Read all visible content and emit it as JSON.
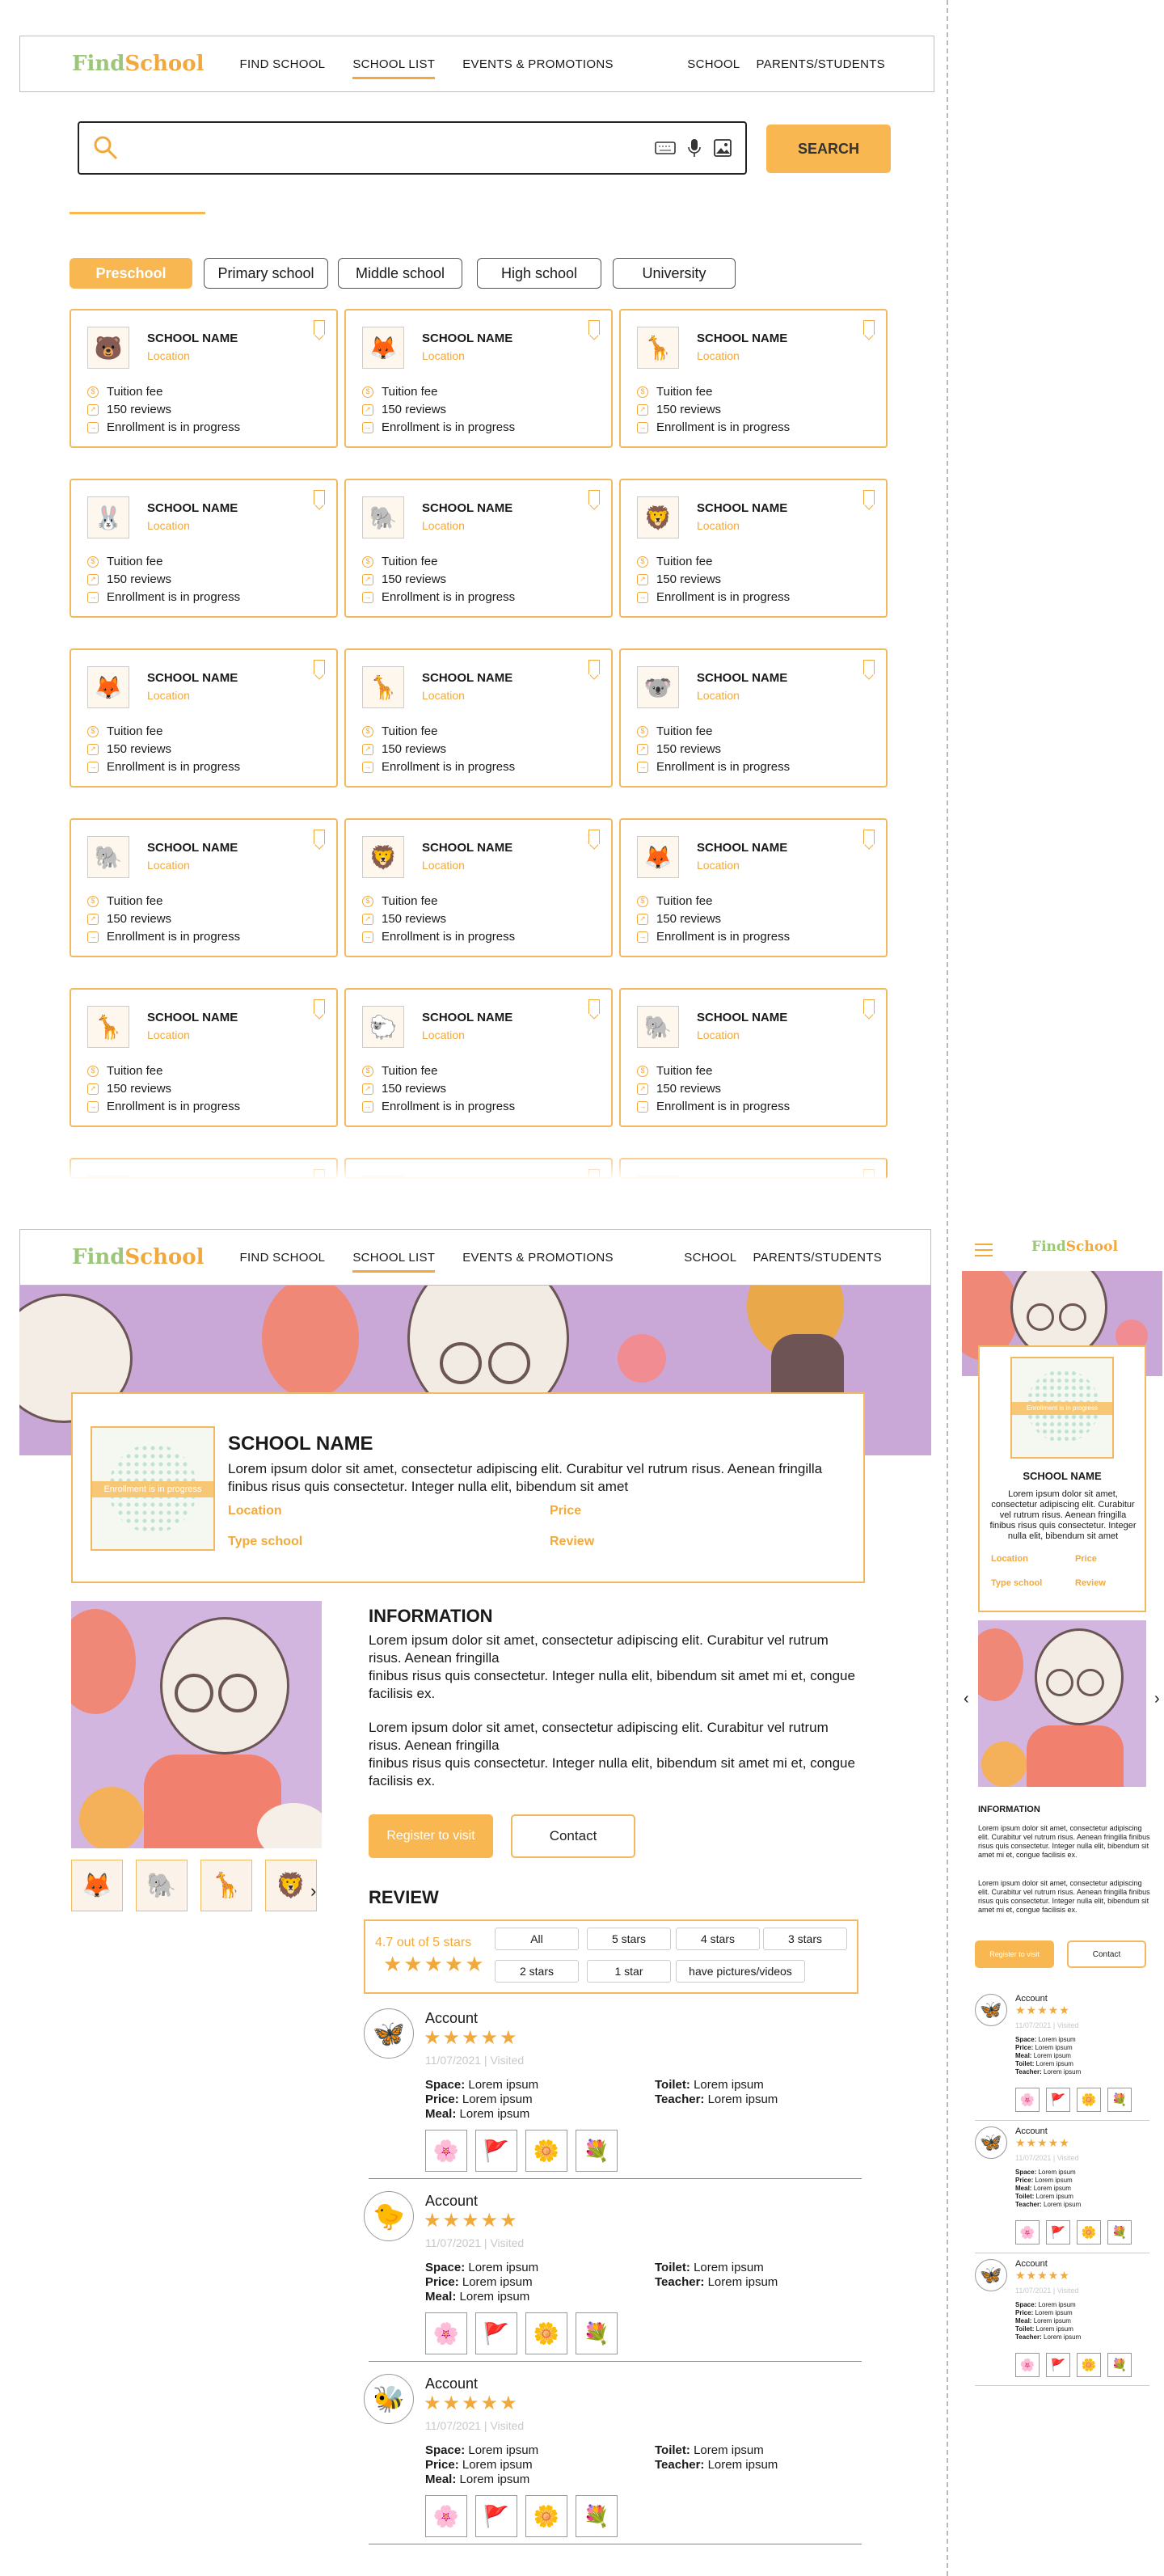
{
  "brand": {
    "logo_a": "Find",
    "logo_b": "School"
  },
  "nav": {
    "find_school": "FIND SCHOOL",
    "school_list": "SCHOOL LIST",
    "events": "EVENTS & PROMOTIONS",
    "school": "SCHOOL",
    "parents": "PARENTS/STUDENTS"
  },
  "search": {
    "placeholder": "",
    "button": "SEARCH"
  },
  "filters": [
    "Preschool",
    "Primary school",
    "Middle school",
    "High school",
    "University"
  ],
  "card": {
    "name": "SCHOOL NAME",
    "location": "Location",
    "fee": "Tuition fee",
    "reviews": "150 reviews",
    "status": "Enrollment is in progress"
  },
  "detail": {
    "name": "SCHOOL NAME",
    "desc": "Lorem ipsum dolor sit amet, consectetur adipiscing elit. Curabitur vel rutrum risus. Aenean fringilla finibus risus quis consectetur. Integer nulla elit, bibendum sit amet",
    "location": "Location",
    "price": "Price",
    "type": "Type school",
    "review": "Review",
    "badge": "Enrollment is in progress",
    "info_title": "INFORMATION",
    "info_p1a": "Lorem ipsum dolor sit amet, consectetur adipiscing elit. Curabitur vel rutrum risus. Aenean fringilla",
    "info_p1b": "finibus risus quis consectetur. Integer nulla elit, bibendum sit amet mi et, congue facilisis ex.",
    "register": "Register to visit",
    "contact": "Contact",
    "review_title": "REVIEW",
    "rating": "4.7 out of 5 stars",
    "stars": "★★★★★"
  },
  "review_filters": [
    "All",
    "5 stars",
    "4 stars",
    "3 stars",
    "2 stars",
    "1 star",
    "have pictures/videos"
  ],
  "review": {
    "account": "Account",
    "date": "11/07/2021 | Visited",
    "space_l": "Space:",
    "price_l": "Price:",
    "meal_l": "Meal:",
    "toilet_l": "Toilet:",
    "teacher_l": "Teacher:",
    "val": "Lorem ipsum"
  },
  "mobile_info": {
    "info_p": "Lorem ipsum dolor sit amet, consectetur adipiscing elit. Curabitur vel rutrum risus. Aenean fringilla finibus risus quis consectetur. Integer nulla elit, bibendum sit amet mi et, congue facilisis ex."
  },
  "carousel": {
    "prev": "‹",
    "next": "›"
  },
  "menu_icon": "hamburger-icon",
  "colors": {
    "accent": "#f8b751",
    "green": "#9cc67a",
    "lilac": "#c9a8d8"
  }
}
